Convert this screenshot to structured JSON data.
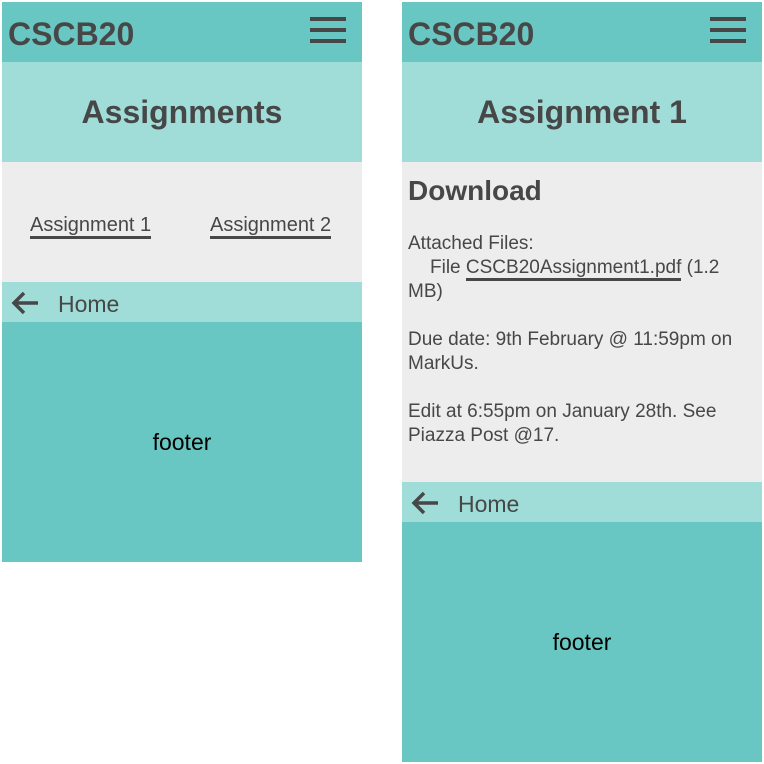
{
  "left": {
    "brand": "CSCB20",
    "page_title": "Assignments",
    "links": [
      {
        "label": "Assignment 1"
      },
      {
        "label": "Assignment 2"
      }
    ],
    "home_label": "Home",
    "footer": "footer"
  },
  "right": {
    "brand": "CSCB20",
    "page_title": "Assignment 1",
    "section_title": "Download",
    "attached_label": "Attached Files:",
    "file_prefix": "File ",
    "file_name": "CSCB20Assignment1.pdf",
    "file_size": " (1.2 MB)",
    "due_date": "Due date: 9th February @ 11:59pm on MarkUs.",
    "edit_note": "Edit at 6:55pm on January 28th. See Piazza Post @17.",
    "home_label": "Home",
    "footer": "footer"
  },
  "icons": {
    "menu": "hamburger-menu-icon",
    "back": "arrow-left-icon"
  },
  "colors": {
    "header": "#68c7c2",
    "hero": "#a0ddd8",
    "body": "#ededee",
    "text": "#474747"
  }
}
